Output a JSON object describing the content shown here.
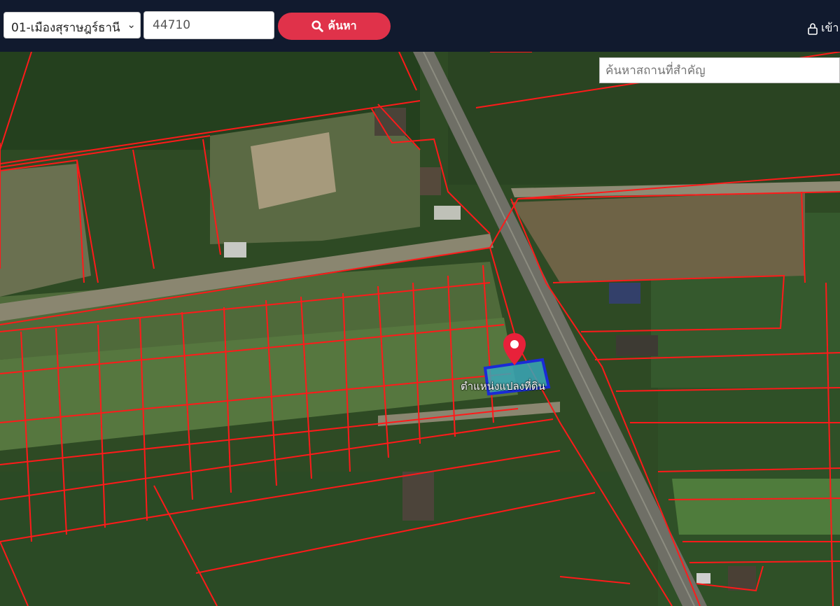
{
  "topbar": {
    "district_select": "01-เมืองสุราษฎร์ธานี",
    "postcode_value": "44710",
    "search_label": "ค้นหา",
    "login_label": "เข้า"
  },
  "map": {
    "landmark_placeholder": "ค้นหาสถานที่สำคัญ",
    "parcel_label": "ตำแหน่งแปลงที่ดิน",
    "colors": {
      "parcel_line": "#ff1a1a",
      "selected_parcel": "#1a2bd6",
      "pin": "#e8213a"
    }
  }
}
